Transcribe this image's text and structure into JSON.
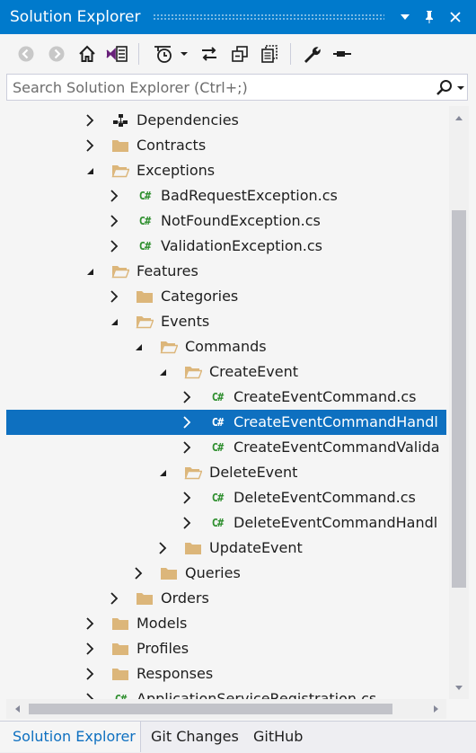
{
  "window": {
    "title": "Solution Explorer"
  },
  "search": {
    "placeholder": "Search Solution Explorer (Ctrl+;)"
  },
  "colors": {
    "accent": "#007acc",
    "selection": "#0e70c0",
    "folder": "#dcb67a",
    "csharp": "#2f8f2f"
  },
  "tree": [
    {
      "label": "Dependencies",
      "icon": "dependencies-icon",
      "expanded": false
    },
    {
      "label": "Contracts",
      "icon": "folder-icon",
      "expanded": false
    },
    {
      "label": "Exceptions",
      "icon": "folder-open-icon",
      "expanded": true
    },
    {
      "label": "BadRequestException.cs",
      "icon": "csharp-file-icon",
      "expanded": false
    },
    {
      "label": "NotFoundException.cs",
      "icon": "csharp-file-icon",
      "expanded": false
    },
    {
      "label": "ValidationException.cs",
      "icon": "csharp-file-icon",
      "expanded": false
    },
    {
      "label": "Features",
      "icon": "folder-open-icon",
      "expanded": true
    },
    {
      "label": "Categories",
      "icon": "folder-icon",
      "expanded": false
    },
    {
      "label": "Events",
      "icon": "folder-open-icon",
      "expanded": true
    },
    {
      "label": "Commands",
      "icon": "folder-open-icon",
      "expanded": true
    },
    {
      "label": "CreateEvent",
      "icon": "folder-open-icon",
      "expanded": true
    },
    {
      "label": "CreateEventCommand.cs",
      "icon": "csharp-file-icon",
      "expanded": false
    },
    {
      "label": "CreateEventCommandHandl",
      "icon": "csharp-file-icon",
      "expanded": false,
      "selected": true
    },
    {
      "label": "CreateEventCommandValida",
      "icon": "csharp-file-icon",
      "expanded": false
    },
    {
      "label": "DeleteEvent",
      "icon": "folder-open-icon",
      "expanded": true
    },
    {
      "label": "DeleteEventCommand.cs",
      "icon": "csharp-file-icon",
      "expanded": false
    },
    {
      "label": "DeleteEventCommandHandl",
      "icon": "csharp-file-icon",
      "expanded": false
    },
    {
      "label": "UpdateEvent",
      "icon": "folder-icon",
      "expanded": false
    },
    {
      "label": "Queries",
      "icon": "folder-icon",
      "expanded": false
    },
    {
      "label": "Orders",
      "icon": "folder-icon",
      "expanded": false
    },
    {
      "label": "Models",
      "icon": "folder-icon",
      "expanded": false
    },
    {
      "label": "Profiles",
      "icon": "folder-icon",
      "expanded": false
    },
    {
      "label": "Responses",
      "icon": "folder-icon",
      "expanded": false
    },
    {
      "label": "ApplicationServiceRegistration.cs",
      "icon": "csharp-file-icon",
      "expanded": false
    }
  ],
  "tabs": [
    {
      "label": "Solution Explorer",
      "active": true
    },
    {
      "label": "Git Changes",
      "active": false
    },
    {
      "label": "GitHub",
      "active": false
    }
  ]
}
